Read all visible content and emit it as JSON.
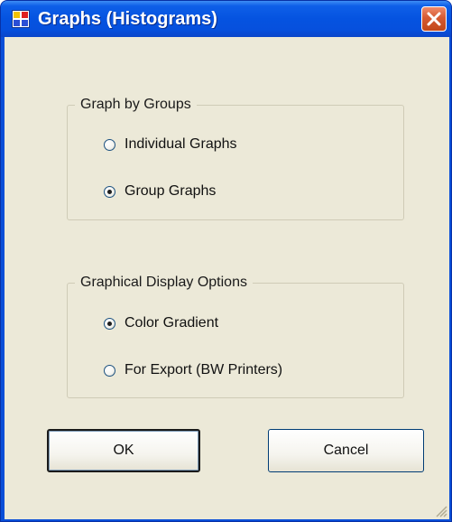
{
  "window": {
    "title": "Graphs (Histograms)"
  },
  "group_by": {
    "label": "Graph by Groups",
    "options": [
      {
        "label": "Individual Graphs",
        "checked": false
      },
      {
        "label": "Group Graphs",
        "checked": true
      }
    ]
  },
  "display_options": {
    "label": "Graphical Display Options",
    "options": [
      {
        "label": "Color Gradient",
        "checked": true
      },
      {
        "label": "For Export (BW Printers)",
        "checked": false
      }
    ]
  },
  "buttons": {
    "ok": "OK",
    "cancel": "Cancel"
  },
  "icons": {
    "app": "app-icon",
    "close": "close-icon",
    "grip": "resize-grip-icon"
  },
  "colors": {
    "titlebar": "#0553e0",
    "client": "#ece9d8",
    "close": "#d65a32"
  }
}
